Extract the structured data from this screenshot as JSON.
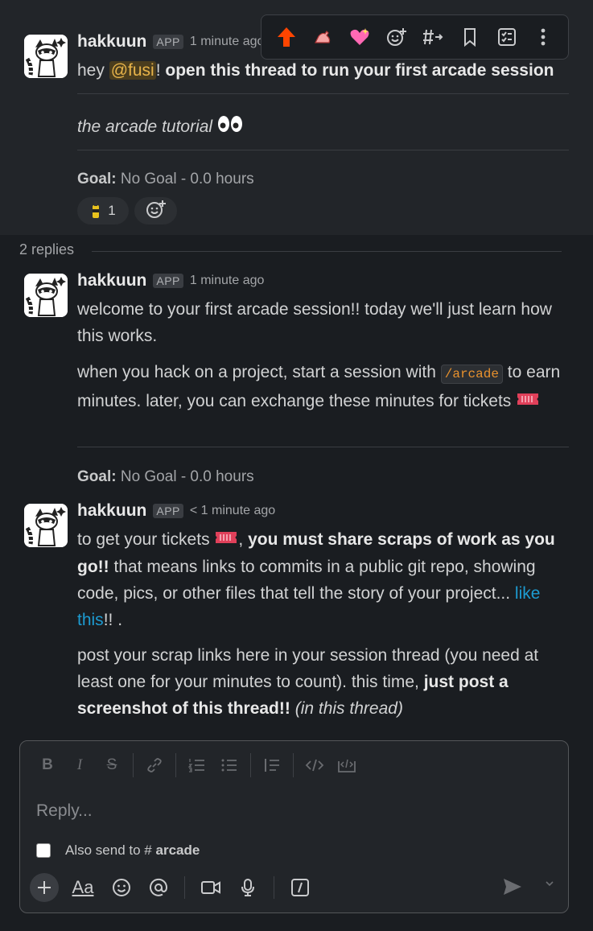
{
  "toolbar": {
    "items": [
      "upvote-icon",
      "point-icon",
      "sparkle-heart-icon",
      "add-reaction-icon",
      "reply-in-channel-icon",
      "bookmark-icon",
      "checklist-icon",
      "more-icon"
    ]
  },
  "parent": {
    "author": "hakkuun",
    "badge": "APP",
    "time": "1 minute ago",
    "text_pre": "hey ",
    "mention": "@fusi",
    "text_bang": "! ",
    "text_bold": "open this thread to run your first arcade session",
    "tutorial": "the arcade tutorial",
    "goal_label": "Goal:",
    "goal_value": " No Goal - 0.0 hours",
    "reaction_count": "1"
  },
  "replies_label": "2 replies",
  "reply1": {
    "author": "hakkuun",
    "badge": "APP",
    "time": "1 minute ago",
    "line1": "welcome to your first arcade session!! today we'll just learn how this works.",
    "p2_pre": "when you hack on a project, start a session with ",
    "p2_code": "/arcade",
    "p2_post": " to earn minutes. later, you can exchange these minutes for tickets ",
    "goal_label": "Goal:",
    "goal_value": " No Goal - 0.0 hours"
  },
  "reply2": {
    "author": "hakkuun",
    "badge": "APP",
    "time": "< 1 minute ago",
    "p1_pre": "to get your tickets ",
    "p1_bold": "you must share scraps of work as you go!!",
    "p1_post": " that means links to commits in a public git repo, showing code, pics, or other files that tell the story of your project... ",
    "p1_link": "like this",
    "p1_end": "!! .",
    "p2_pre": "post your scrap links here in your session thread (you need at least one for your minutes to count). this time, ",
    "p2_bold": "just post a screenshot of this thread!!",
    "p2_italic": " (in this thread)"
  },
  "composer": {
    "placeholder": "Reply...",
    "also_send": "Also send to",
    "channel_hash": "#",
    "channel": "arcade",
    "aa": "Aa"
  }
}
